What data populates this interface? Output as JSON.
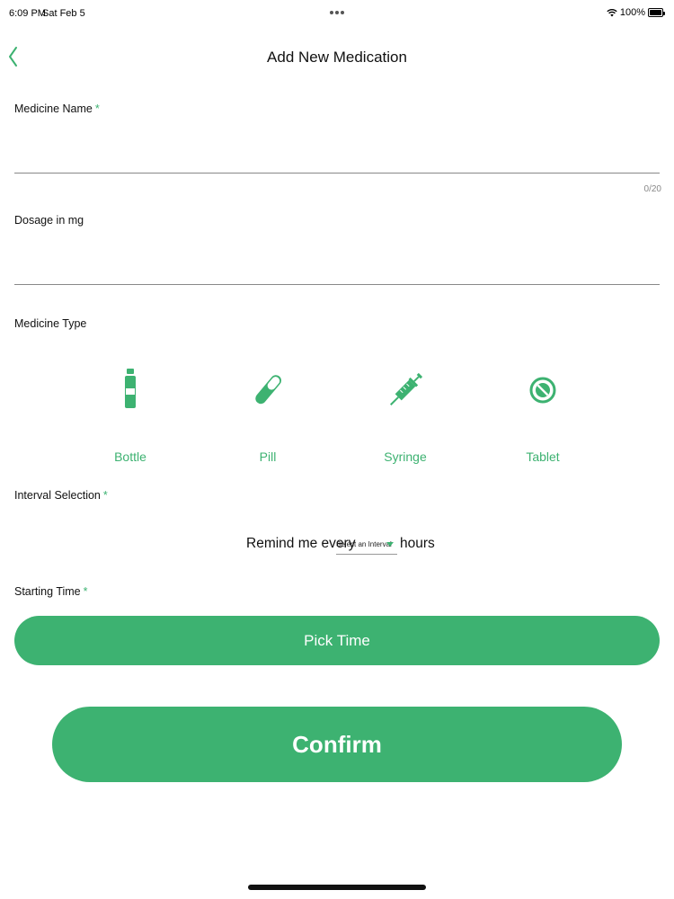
{
  "status_bar": {
    "time": "6:09 PM",
    "date": "Sat Feb 5",
    "battery": "100%"
  },
  "nav": {
    "title": "Add New Medication",
    "back_icon": "chevron-left-icon"
  },
  "form": {
    "medicine_name": {
      "label": "Medicine Name",
      "required_mark": "*",
      "value": "",
      "counter": "0/20"
    },
    "dosage": {
      "label": "Dosage in mg",
      "value": ""
    },
    "medicine_type": {
      "label": "Medicine Type",
      "options": [
        {
          "label": "Bottle",
          "icon": "bottle-icon"
        },
        {
          "label": "Pill",
          "icon": "pill-icon"
        },
        {
          "label": "Syringe",
          "icon": "syringe-icon"
        },
        {
          "label": "Tablet",
          "icon": "tablet-icon"
        }
      ]
    },
    "interval": {
      "label": "Interval Selection",
      "required_mark": "*",
      "prefix": "Remind me every",
      "select_placeholder": "Select an Interval",
      "suffix": "hours"
    },
    "starting_time": {
      "label": "Starting Time",
      "required_mark": "*",
      "button_label": "Pick Time"
    }
  },
  "confirm_label": "Confirm",
  "colors": {
    "accent": "#3db271",
    "text": "#111111",
    "divider": "#888888"
  }
}
